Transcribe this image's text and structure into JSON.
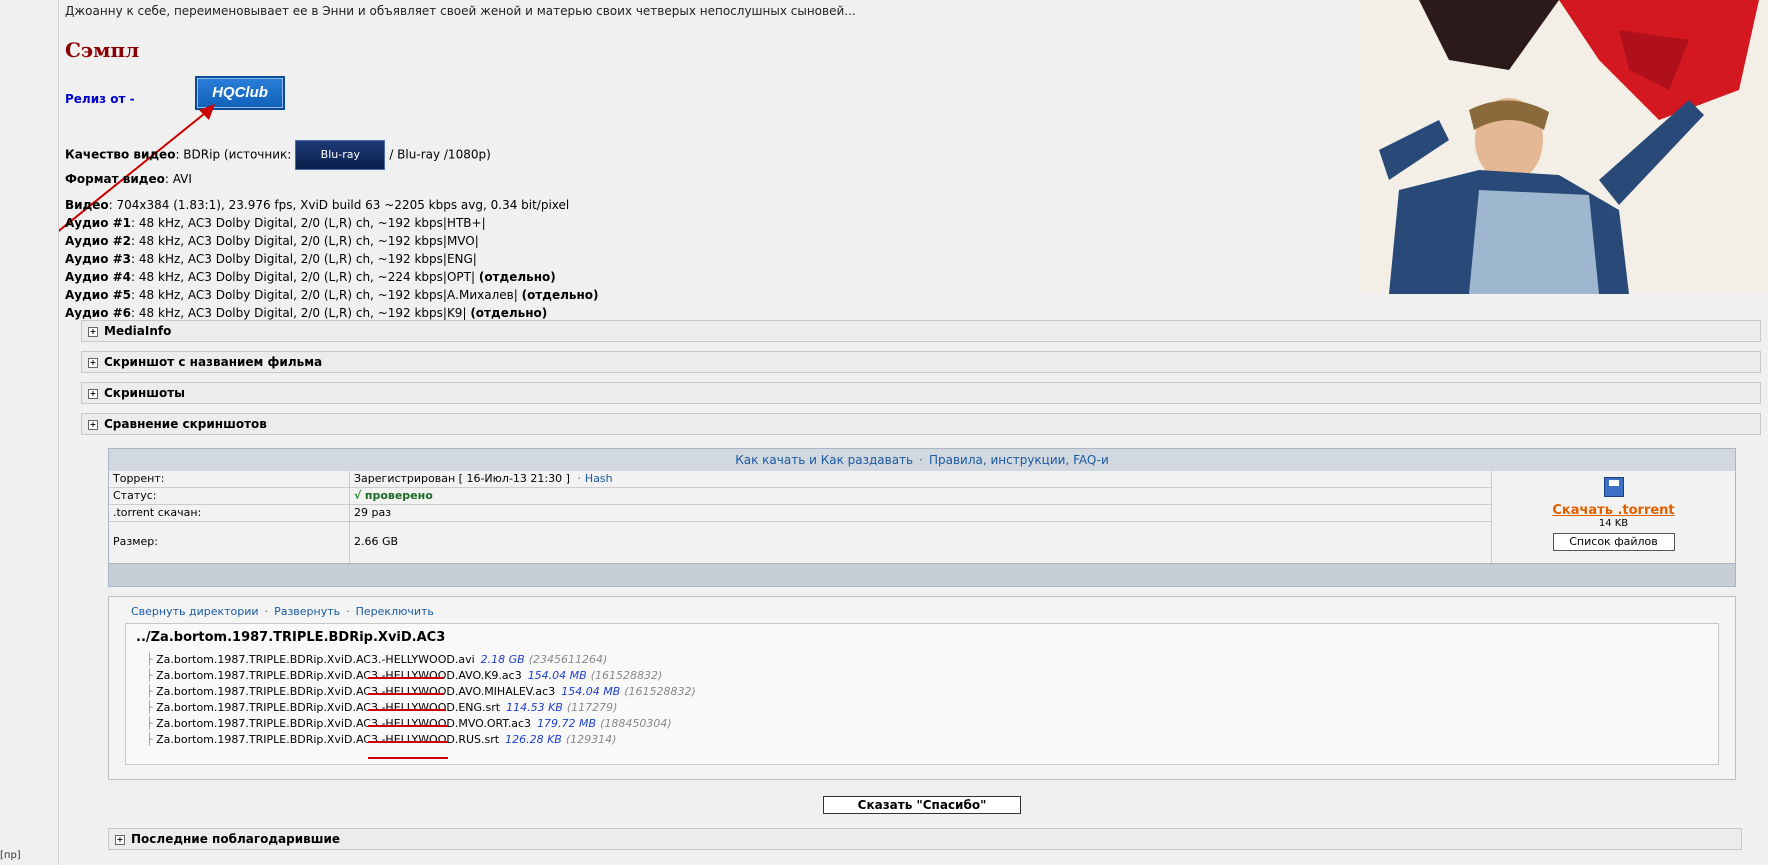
{
  "intro_text": "Джоанну к себе, переименовывает ее в Энни и объявляет своей женой и матерью своих четверых непослушных сыновей...",
  "sample_title": "Сэмпл",
  "release_label": "Релиз от -",
  "release_logo": "HQClub",
  "specs": {
    "quality_label": "Качество видео",
    "quality_value": ": BDRip (источник:",
    "bluray_logo": "Blu-ray",
    "quality_tail": "/ Blu-ray /1080p)",
    "format_label": "Формат видео",
    "format_value": ": AVI",
    "video_label": "Видео",
    "video_value": ": 704x384 (1.83:1), 23.976 fps, XviD build 63 ~2205 kbps avg, 0.34 bit/pixel",
    "audio": [
      {
        "label": "Аудио #1",
        "value": ": 48 kHz, AC3 Dolby Digital, 2/0 (L,R) ch, ~192 kbps|HTB+|",
        "extra": ""
      },
      {
        "label": "Аудио #2",
        "value": ": 48 kHz, AC3 Dolby Digital, 2/0 (L,R) ch, ~192 kbps|MVO|",
        "extra": ""
      },
      {
        "label": "Аудио #3",
        "value": ": 48 kHz, AC3 Dolby Digital, 2/0 (L,R) ch, ~192 kbps|ENG|",
        "extra": ""
      },
      {
        "label": "Аудио #4",
        "value": ": 48 kHz, AC3 Dolby Digital, 2/0 (L,R) ch, ~224 kbps|OPT|",
        "extra": "(отдельно)"
      },
      {
        "label": "Аудио #5",
        "value": ": 48 kHz, AC3 Dolby Digital, 2/0 (L,R) ch, ~192 kbps|А.Михалев|",
        "extra": "(отдельно)"
      },
      {
        "label": "Аудио #6",
        "value": ": 48 kHz, AC3 Dolby Digital, 2/0 (L,R) ch, ~192 kbps|K9|",
        "extra": "(отдельно)"
      }
    ]
  },
  "spoilers": [
    "MediaInfo",
    "Скриншот с названием фильма",
    "Скриншоты",
    "Сравнение скриншотов"
  ],
  "torrent": {
    "head_link1": "Как качать и Как раздавать",
    "head_link2": "Правила, инструкции, FAQ-и",
    "sep": "·",
    "rows": {
      "torrent_key": "Торрент:",
      "torrent_val": "Зарегистрирован  [ 16-Июл-13 21:30 ]",
      "hash": "Hash",
      "status_key": "Статус:",
      "status_check": "√",
      "status_val": "проверено",
      "downloaded_key": ".torrent скачан:",
      "downloaded_val": "29 раз",
      "size_key": "Размер:",
      "size_val": "2.66 GB"
    },
    "download_link": "Скачать .torrent",
    "download_size": "14 KB",
    "filelist_button": "Список файлов",
    "disk_icon": "floppy-disk-icon"
  },
  "files": {
    "collapse": "Свернуть директории",
    "expand": "Развернуть",
    "toggle": "Переключить",
    "root": "../Za.bortom.1987.TRIPLE.BDRip.XviD.AC3",
    "items": [
      {
        "name": "Za.bortom.1987.TRIPLE.BDRip.XviD.AC3.-HELLYWOOD.avi",
        "size": "2.18 GB",
        "bytes": "(2345611264)"
      },
      {
        "name": "Za.bortom.1987.TRIPLE.BDRip.XviD.AC3.-HELLYWOOD.AVO.K9.ac3",
        "size": "154.04 MB",
        "bytes": "(161528832)"
      },
      {
        "name": "Za.bortom.1987.TRIPLE.BDRip.XviD.AC3.-HELLYWOOD.AVO.MIHALEV.ac3",
        "size": "154.04 MB",
        "bytes": "(161528832)"
      },
      {
        "name": "Za.bortom.1987.TRIPLE.BDRip.XviD.AC3.-HELLYWOOD.ENG.srt",
        "size": "114.53 KB",
        "bytes": "(117279)"
      },
      {
        "name": "Za.bortom.1987.TRIPLE.BDRip.XviD.AC3.-HELLYWOOD.MVO.ORT.ac3",
        "size": "179.72 MB",
        "bytes": "(188450304)"
      },
      {
        "name": "Za.bortom.1987.TRIPLE.BDRip.XviD.AC3.-HELLYWOOD.RUS.srt",
        "size": "126.28 KB",
        "bytes": "(129314)"
      }
    ]
  },
  "thanks_button": "Сказать \"Спасибо\"",
  "last_thanked": "Последние поблагодарившие",
  "left_stub": "[пр]",
  "colors": {
    "accent_link": "#1a5aa0",
    "sample_title": "#8b0000",
    "download": "#e06000",
    "annotation": "#cc0000"
  }
}
